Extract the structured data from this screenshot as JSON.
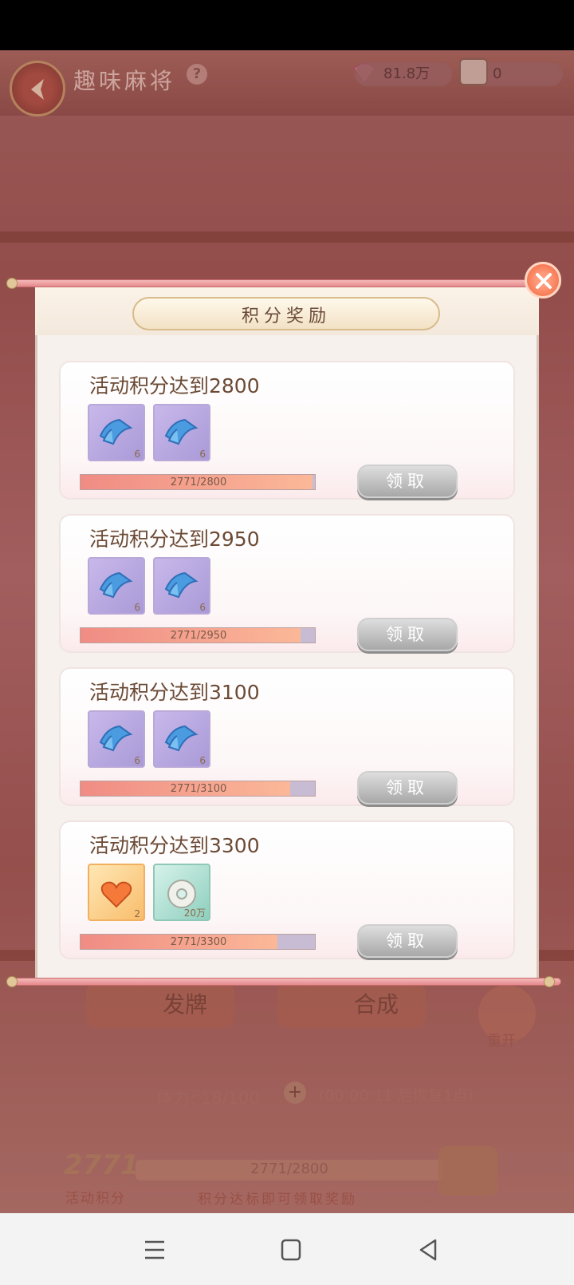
{
  "game": {
    "title": "趣味麻将",
    "help_glyph": "?",
    "gems": "81.8万",
    "tiles": "0",
    "deal_label": "发牌",
    "merge_label": "合成",
    "reset_label": "重开",
    "stamina_text": "体力: 18/100",
    "stamina_timer": "(00:00:11 后恢复1点)",
    "score_value": "2771",
    "score_label": "活动积分",
    "score_progress": "2771/2800",
    "score_hint": "积分达标即可领取奖励"
  },
  "modal": {
    "title": "积分奖励",
    "claim_label": "领取",
    "rewards": [
      {
        "title": "活动积分达到2800",
        "progress": "2771/2800",
        "fraction": 0.9896,
        "items": [
          {
            "icon": "cloth-icon",
            "count": "6"
          },
          {
            "icon": "cloth-icon",
            "count": "6"
          }
        ]
      },
      {
        "title": "活动积分达到2950",
        "progress": "2771/2950",
        "fraction": 0.9393,
        "items": [
          {
            "icon": "cloth-icon",
            "count": "6"
          },
          {
            "icon": "cloth-icon",
            "count": "6"
          }
        ]
      },
      {
        "title": "活动积分达到3100",
        "progress": "2771/3100",
        "fraction": 0.8939,
        "items": [
          {
            "icon": "cloth-icon",
            "count": "6"
          },
          {
            "icon": "cloth-icon",
            "count": "6"
          }
        ]
      },
      {
        "title": "活动积分达到3300",
        "progress": "2771/3300",
        "fraction": 0.8397,
        "items": [
          {
            "icon": "heart-card-icon",
            "count": "2"
          },
          {
            "icon": "jade-pendant-icon",
            "count": "20万"
          }
        ]
      }
    ]
  },
  "colors": {
    "accent": "#f0643a",
    "progress_fill": "#f08c84",
    "claim_disabled": "#a8a8a8"
  }
}
